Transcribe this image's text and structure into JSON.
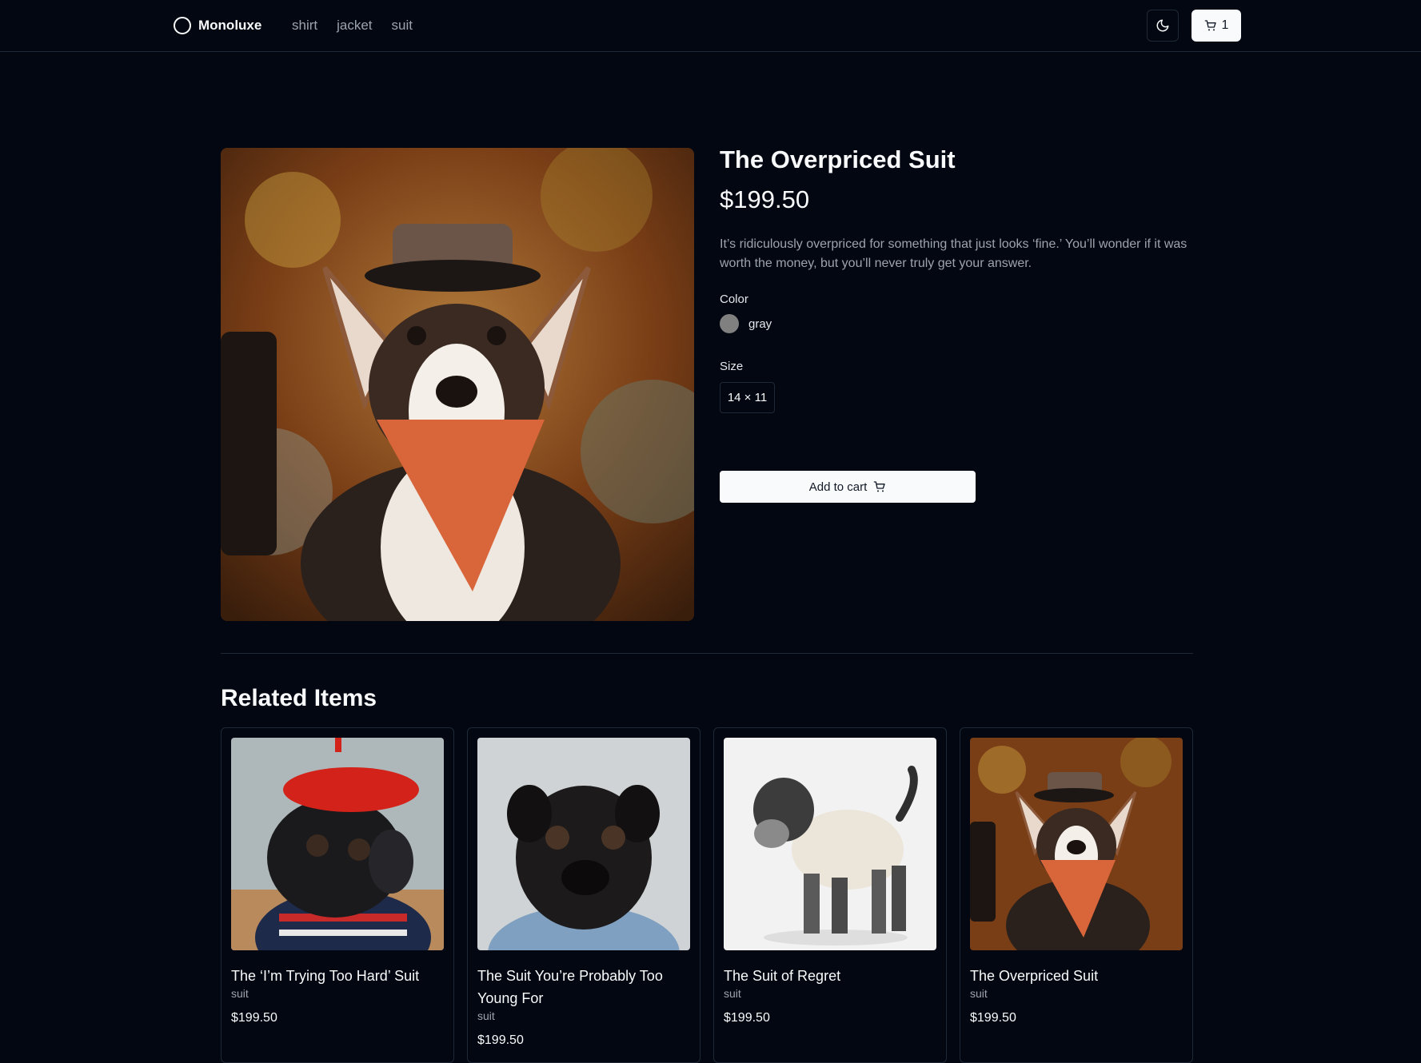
{
  "header": {
    "brand": "Monoluxe",
    "nav": [
      "shirt",
      "jacket",
      "suit"
    ],
    "cart_count": "1"
  },
  "product": {
    "title": "The Overpriced Suit",
    "price": "$199.50",
    "description": "It’s ridiculously overpriced for something that just looks ‘fine.’ You’ll wonder if it was worth the money, but you’ll never truly get your answer.",
    "color_label": "Color",
    "color_value": "gray",
    "color_hex": "#808080",
    "size_label": "Size",
    "size_value": "14 × 11",
    "add_to_cart": "Add to cart"
  },
  "related": {
    "title": "Related Items",
    "items": [
      {
        "name": "The ‘I’m Trying Too Hard’ Suit",
        "category": "suit",
        "price": "$199.50",
        "image": "black pug wearing red beret"
      },
      {
        "name": "The Suit You’re Probably Too Young For",
        "category": "suit",
        "price": "$199.50",
        "image": "black pug in denim jacket"
      },
      {
        "name": "The Suit of Regret",
        "category": "suit",
        "price": "$199.50",
        "image": "schnauzer in cream sweater"
      },
      {
        "name": "The Overpriced Suit",
        "category": "suit",
        "price": "$199.50",
        "image": "corgi wearing hat and orange bandana"
      }
    ]
  }
}
